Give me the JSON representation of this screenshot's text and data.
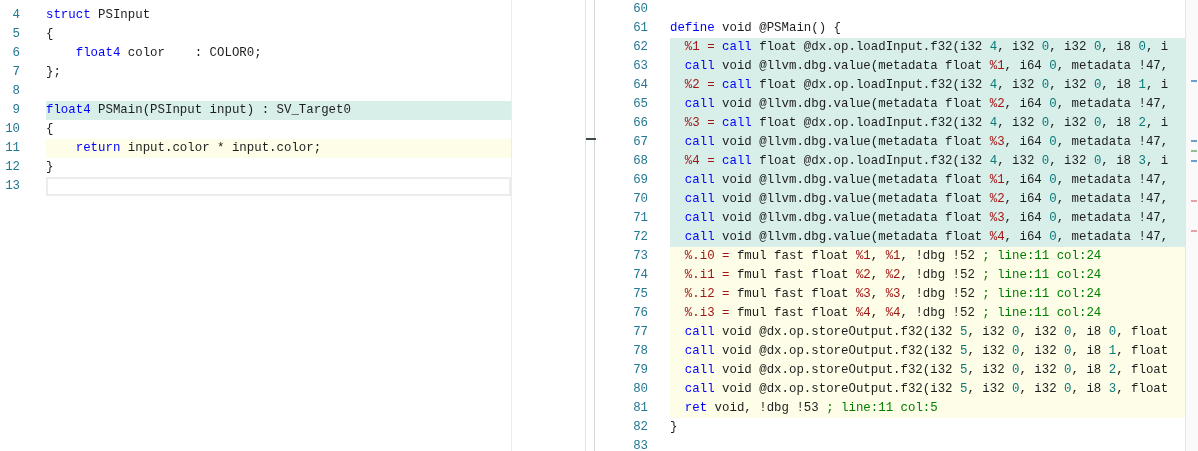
{
  "editors": [
    {
      "lines": [
        {
          "number": "4",
          "kind": "plain",
          "tokens": [
            {
              "text": "struct",
              "kind": "keyword"
            },
            {
              "text": " PSInput",
              "kind": "plain"
            }
          ]
        },
        {
          "number": "5",
          "kind": "plain",
          "tokens": [
            {
              "text": "{",
              "kind": "plain"
            }
          ]
        },
        {
          "number": "6",
          "kind": "plain",
          "indented": true,
          "tokens": [
            {
              "text": "float4",
              "kind": "keyword"
            },
            {
              "text": " color    : COLOR0;",
              "kind": "plain"
            }
          ]
        },
        {
          "number": "7",
          "kind": "plain",
          "tokens": [
            {
              "text": "};",
              "kind": "plain"
            }
          ]
        },
        {
          "number": "8",
          "kind": "plain"
        },
        {
          "number": "9",
          "kind": "match",
          "tokens": [
            {
              "text": "float4",
              "kind": "keyword"
            },
            {
              "text": " PSMain(PSInput input) : SV_Target0",
              "kind": "plain"
            }
          ]
        },
        {
          "number": "10",
          "kind": "plain",
          "tokens": [
            {
              "text": "{",
              "kind": "plain"
            }
          ]
        },
        {
          "number": "11",
          "kind": "active",
          "indented": true,
          "tokens": [
            {
              "text": "return",
              "kind": "keyword"
            },
            {
              "text": " input.color * input.color;",
              "kind": "plain"
            }
          ]
        },
        {
          "number": "12",
          "kind": "plain",
          "tokens": [
            {
              "text": "}",
              "kind": "plain"
            }
          ]
        },
        {
          "number": "13",
          "kind": "cursor"
        }
      ]
    },
    {
      "lines": [
        {
          "number": "60",
          "kind": "plain"
        },
        {
          "number": "61",
          "kind": "plain",
          "tokens": [
            {
              "text": "define",
              "kind": "keyword"
            },
            {
              "text": " void @PSMain() {",
              "kind": "plain"
            }
          ]
        },
        {
          "number": "62",
          "kind": "match",
          "indented": true,
          "tokens": [
            {
              "text": "%1 =",
              "kind": "variable"
            },
            {
              "text": " call",
              "kind": "keyword"
            },
            {
              "text": " float @dx.op.loadInput.f32(i32 ",
              "kind": "plain"
            },
            {
              "text": "4",
              "kind": "number"
            },
            {
              "text": ", i32 ",
              "kind": "plain"
            },
            {
              "text": "0",
              "kind": "number"
            },
            {
              "text": ", i32 ",
              "kind": "plain"
            },
            {
              "text": "0",
              "kind": "number"
            },
            {
              "text": ", i8 ",
              "kind": "plain"
            },
            {
              "text": "0",
              "kind": "number"
            },
            {
              "text": ", i",
              "kind": "plain"
            }
          ]
        },
        {
          "number": "63",
          "kind": "match",
          "indented": true,
          "tokens": [
            {
              "text": "call",
              "kind": "keyword"
            },
            {
              "text": " void @llvm.dbg.value(metadata float ",
              "kind": "plain"
            },
            {
              "text": "%1",
              "kind": "variable"
            },
            {
              "text": ", i64 ",
              "kind": "plain"
            },
            {
              "text": "0",
              "kind": "number"
            },
            {
              "text": ", metadata !47,",
              "kind": "plain"
            }
          ]
        },
        {
          "number": "64",
          "kind": "match",
          "indented": true,
          "tokens": [
            {
              "text": "%2 =",
              "kind": "variable"
            },
            {
              "text": " call",
              "kind": "keyword"
            },
            {
              "text": " float @dx.op.loadInput.f32(i32 ",
              "kind": "plain"
            },
            {
              "text": "4",
              "kind": "number"
            },
            {
              "text": ", i32 ",
              "kind": "plain"
            },
            {
              "text": "0",
              "kind": "number"
            },
            {
              "text": ", i32 ",
              "kind": "plain"
            },
            {
              "text": "0",
              "kind": "number"
            },
            {
              "text": ", i8 ",
              "kind": "plain"
            },
            {
              "text": "1",
              "kind": "number"
            },
            {
              "text": ", i",
              "kind": "plain"
            }
          ]
        },
        {
          "number": "65",
          "kind": "match",
          "indented": true,
          "tokens": [
            {
              "text": "call",
              "kind": "keyword"
            },
            {
              "text": " void @llvm.dbg.value(metadata float ",
              "kind": "plain"
            },
            {
              "text": "%2",
              "kind": "variable"
            },
            {
              "text": ", i64 ",
              "kind": "plain"
            },
            {
              "text": "0",
              "kind": "number"
            },
            {
              "text": ", metadata !47,",
              "kind": "plain"
            }
          ]
        },
        {
          "number": "66",
          "kind": "match",
          "indented": true,
          "tokens": [
            {
              "text": "%3 =",
              "kind": "variable"
            },
            {
              "text": " call",
              "kind": "keyword"
            },
            {
              "text": " float @dx.op.loadInput.f32(i32 ",
              "kind": "plain"
            },
            {
              "text": "4",
              "kind": "number"
            },
            {
              "text": ", i32 ",
              "kind": "plain"
            },
            {
              "text": "0",
              "kind": "number"
            },
            {
              "text": ", i32 ",
              "kind": "plain"
            },
            {
              "text": "0",
              "kind": "number"
            },
            {
              "text": ", i8 ",
              "kind": "plain"
            },
            {
              "text": "2",
              "kind": "number"
            },
            {
              "text": ", i",
              "kind": "plain"
            }
          ]
        },
        {
          "number": "67",
          "kind": "match",
          "indented": true,
          "tokens": [
            {
              "text": "call",
              "kind": "keyword"
            },
            {
              "text": " void @llvm.dbg.value(metadata float ",
              "kind": "plain"
            },
            {
              "text": "%3",
              "kind": "variable"
            },
            {
              "text": ", i64 ",
              "kind": "plain"
            },
            {
              "text": "0",
              "kind": "number"
            },
            {
              "text": ", metadata !47,",
              "kind": "plain"
            }
          ]
        },
        {
          "number": "68",
          "kind": "match",
          "indented": true,
          "tokens": [
            {
              "text": "%4 =",
              "kind": "variable"
            },
            {
              "text": " call",
              "kind": "keyword"
            },
            {
              "text": " float @dx.op.loadInput.f32(i32 ",
              "kind": "plain"
            },
            {
              "text": "4",
              "kind": "number"
            },
            {
              "text": ", i32 ",
              "kind": "plain"
            },
            {
              "text": "0",
              "kind": "number"
            },
            {
              "text": ", i32 ",
              "kind": "plain"
            },
            {
              "text": "0",
              "kind": "number"
            },
            {
              "text": ", i8 ",
              "kind": "plain"
            },
            {
              "text": "3",
              "kind": "number"
            },
            {
              "text": ", i",
              "kind": "plain"
            }
          ]
        },
        {
          "number": "69",
          "kind": "match",
          "indented": true,
          "tokens": [
            {
              "text": "call",
              "kind": "keyword"
            },
            {
              "text": " void @llvm.dbg.value(metadata float ",
              "kind": "plain"
            },
            {
              "text": "%1",
              "kind": "variable"
            },
            {
              "text": ", i64 ",
              "kind": "plain"
            },
            {
              "text": "0",
              "kind": "number"
            },
            {
              "text": ", metadata !47,",
              "kind": "plain"
            }
          ]
        },
        {
          "number": "70",
          "kind": "match",
          "indented": true,
          "tokens": [
            {
              "text": "call",
              "kind": "keyword"
            },
            {
              "text": " void @llvm.dbg.value(metadata float ",
              "kind": "plain"
            },
            {
              "text": "%2",
              "kind": "variable"
            },
            {
              "text": ", i64 ",
              "kind": "plain"
            },
            {
              "text": "0",
              "kind": "number"
            },
            {
              "text": ", metadata !47,",
              "kind": "plain"
            }
          ]
        },
        {
          "number": "71",
          "kind": "match",
          "indented": true,
          "tokens": [
            {
              "text": "call",
              "kind": "keyword"
            },
            {
              "text": " void @llvm.dbg.value(metadata float ",
              "kind": "plain"
            },
            {
              "text": "%3",
              "kind": "variable"
            },
            {
              "text": ", i64 ",
              "kind": "plain"
            },
            {
              "text": "0",
              "kind": "number"
            },
            {
              "text": ", metadata !47,",
              "kind": "plain"
            }
          ]
        },
        {
          "number": "72",
          "kind": "match",
          "indented": true,
          "tokens": [
            {
              "text": "call",
              "kind": "keyword"
            },
            {
              "text": " void @llvm.dbg.value(metadata float ",
              "kind": "plain"
            },
            {
              "text": "%4",
              "kind": "variable"
            },
            {
              "text": ", i64 ",
              "kind": "plain"
            },
            {
              "text": "0",
              "kind": "number"
            },
            {
              "text": ", metadata !47,",
              "kind": "plain"
            }
          ]
        },
        {
          "number": "73",
          "kind": "active",
          "indented": true,
          "tokens": [
            {
              "text": "%.i0 =",
              "kind": "variable"
            },
            {
              "text": " fmul fast float ",
              "kind": "plain"
            },
            {
              "text": "%1",
              "kind": "variable"
            },
            {
              "text": ", ",
              "kind": "plain"
            },
            {
              "text": "%1",
              "kind": "variable"
            },
            {
              "text": ", !dbg !52 ",
              "kind": "plain"
            },
            {
              "text": "; line:11 col:24",
              "kind": "comment"
            }
          ]
        },
        {
          "number": "74",
          "kind": "active",
          "indented": true,
          "tokens": [
            {
              "text": "%.i1 =",
              "kind": "variable"
            },
            {
              "text": " fmul fast float ",
              "kind": "plain"
            },
            {
              "text": "%2",
              "kind": "variable"
            },
            {
              "text": ", ",
              "kind": "plain"
            },
            {
              "text": "%2",
              "kind": "variable"
            },
            {
              "text": ", !dbg !52 ",
              "kind": "plain"
            },
            {
              "text": "; line:11 col:24",
              "kind": "comment"
            }
          ]
        },
        {
          "number": "75",
          "kind": "active",
          "indented": true,
          "tokens": [
            {
              "text": "%.i2 =",
              "kind": "variable"
            },
            {
              "text": " fmul fast float ",
              "kind": "plain"
            },
            {
              "text": "%3",
              "kind": "variable"
            },
            {
              "text": ", ",
              "kind": "plain"
            },
            {
              "text": "%3",
              "kind": "variable"
            },
            {
              "text": ", !dbg !52 ",
              "kind": "plain"
            },
            {
              "text": "; line:11 col:24",
              "kind": "comment"
            }
          ]
        },
        {
          "number": "76",
          "kind": "active",
          "indented": true,
          "tokens": [
            {
              "text": "%.i3 =",
              "kind": "variable"
            },
            {
              "text": " fmul fast float ",
              "kind": "plain"
            },
            {
              "text": "%4",
              "kind": "variable"
            },
            {
              "text": ", ",
              "kind": "plain"
            },
            {
              "text": "%4",
              "kind": "variable"
            },
            {
              "text": ", !dbg !52 ",
              "kind": "plain"
            },
            {
              "text": "; line:11 col:24",
              "kind": "comment"
            }
          ]
        },
        {
          "number": "77",
          "kind": "active",
          "indented": true,
          "tokens": [
            {
              "text": "call",
              "kind": "keyword"
            },
            {
              "text": " void @dx.op.storeOutput.f32(i32 ",
              "kind": "plain"
            },
            {
              "text": "5",
              "kind": "number"
            },
            {
              "text": ", i32 ",
              "kind": "plain"
            },
            {
              "text": "0",
              "kind": "number"
            },
            {
              "text": ", i32 ",
              "kind": "plain"
            },
            {
              "text": "0",
              "kind": "number"
            },
            {
              "text": ", i8 ",
              "kind": "plain"
            },
            {
              "text": "0",
              "kind": "number"
            },
            {
              "text": ", float",
              "kind": "plain"
            }
          ]
        },
        {
          "number": "78",
          "kind": "active",
          "indented": true,
          "tokens": [
            {
              "text": "call",
              "kind": "keyword"
            },
            {
              "text": " void @dx.op.storeOutput.f32(i32 ",
              "kind": "plain"
            },
            {
              "text": "5",
              "kind": "number"
            },
            {
              "text": ", i32 ",
              "kind": "plain"
            },
            {
              "text": "0",
              "kind": "number"
            },
            {
              "text": ", i32 ",
              "kind": "plain"
            },
            {
              "text": "0",
              "kind": "number"
            },
            {
              "text": ", i8 ",
              "kind": "plain"
            },
            {
              "text": "1",
              "kind": "number"
            },
            {
              "text": ", float",
              "kind": "plain"
            }
          ]
        },
        {
          "number": "79",
          "kind": "active",
          "indented": true,
          "tokens": [
            {
              "text": "call",
              "kind": "keyword"
            },
            {
              "text": " void @dx.op.storeOutput.f32(i32 ",
              "kind": "plain"
            },
            {
              "text": "5",
              "kind": "number"
            },
            {
              "text": ", i32 ",
              "kind": "plain"
            },
            {
              "text": "0",
              "kind": "number"
            },
            {
              "text": ", i32 ",
              "kind": "plain"
            },
            {
              "text": "0",
              "kind": "number"
            },
            {
              "text": ", i8 ",
              "kind": "plain"
            },
            {
              "text": "2",
              "kind": "number"
            },
            {
              "text": ", float",
              "kind": "plain"
            }
          ]
        },
        {
          "number": "80",
          "kind": "active",
          "indented": true,
          "tokens": [
            {
              "text": "call",
              "kind": "keyword"
            },
            {
              "text": " void @dx.op.storeOutput.f32(i32 ",
              "kind": "plain"
            },
            {
              "text": "5",
              "kind": "number"
            },
            {
              "text": ", i32 ",
              "kind": "plain"
            },
            {
              "text": "0",
              "kind": "number"
            },
            {
              "text": ", i32 ",
              "kind": "plain"
            },
            {
              "text": "0",
              "kind": "number"
            },
            {
              "text": ", i8 ",
              "kind": "plain"
            },
            {
              "text": "3",
              "kind": "number"
            },
            {
              "text": ", float",
              "kind": "plain"
            }
          ]
        },
        {
          "number": "81",
          "kind": "active",
          "indented": true,
          "tokens": [
            {
              "text": "ret",
              "kind": "keyword"
            },
            {
              "text": " void, !dbg !53 ",
              "kind": "plain"
            },
            {
              "text": "; line:11 col:5",
              "kind": "comment"
            }
          ]
        },
        {
          "number": "82",
          "kind": "plain",
          "tokens": [
            {
              "text": "}",
              "kind": "plain"
            }
          ]
        },
        {
          "number": "83",
          "kind": "plain"
        }
      ]
    }
  ]
}
